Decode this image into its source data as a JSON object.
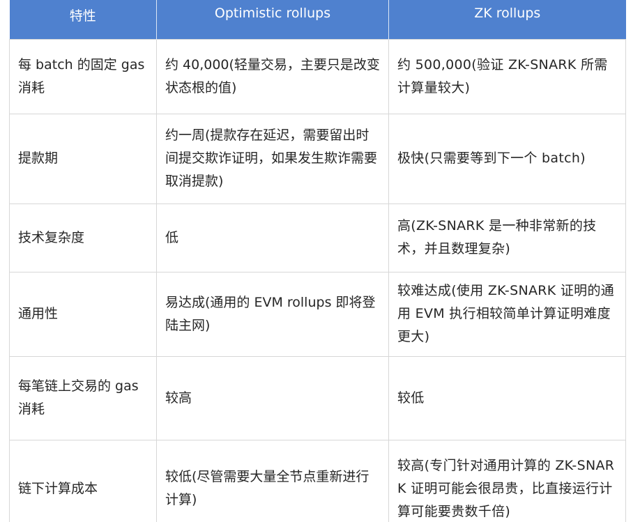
{
  "table": {
    "headers": [
      "特性",
      "Optimistic rollups",
      "ZK rollups"
    ],
    "rows": [
      {
        "feature": "每 batch 的固定 gas 消耗",
        "optimistic": "约 40,000(轻量交易，主要只是改变状态根的值)",
        "zk": "约 500,000(验证 ZK-SNARK 所需计算量较大)"
      },
      {
        "feature": "提款期",
        "optimistic": "约一周(提款存在延迟，需要留出时间提交欺诈证明，如果发生欺诈需要取消提款)",
        "zk": "极快(只需要等到下一个 batch)"
      },
      {
        "feature": "技术复杂度",
        "optimistic": "低",
        "zk": "高(ZK-SNARK 是一种非常新的技术，并且数理复杂)"
      },
      {
        "feature": "通用性",
        "optimistic": "易达成(通用的 EVM rollups 即将登陆主网)",
        "zk": "较难达成(使用 ZK-SNARK 证明的通用 EVM 执行相较简单计算证明难度更大)"
      },
      {
        "feature": "每笔链上交易的 gas 消耗",
        "optimistic": "较高",
        "zk": "较低"
      },
      {
        "feature": "链下计算成本",
        "optimistic": "较低(尽管需要大量全节点重新进行计算)",
        "zk": "较高(专门针对通用计算的 ZK-SNARK 证明可能会很昂贵，比直接运行计算可能要贵数千倍)"
      }
    ]
  }
}
